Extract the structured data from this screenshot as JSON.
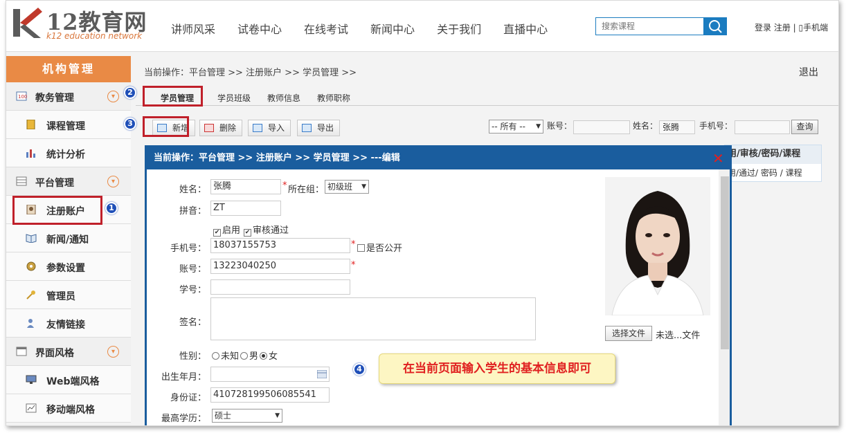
{
  "header": {
    "logo_main": "12教育网",
    "logo_sub": "k12 education network",
    "nav": [
      "讲师风采",
      "试卷中心",
      "在线考试",
      "新闻中心",
      "关于我们",
      "直播中心"
    ],
    "search_placeholder": "搜索课程",
    "top_links": "登录 注册 | ▯手机端"
  },
  "sidebar": {
    "title": "机构管理",
    "items": [
      {
        "label": "教务管理",
        "icon": "score-icon",
        "group": true
      },
      {
        "label": "课程管理",
        "icon": "book-icon"
      },
      {
        "label": "统计分析",
        "icon": "bar-chart-icon"
      },
      {
        "label": "平台管理",
        "icon": "grid-icon",
        "group": true
      },
      {
        "label": "注册账户",
        "icon": "user-card-icon"
      },
      {
        "label": "新闻/通知",
        "icon": "open-book-icon"
      },
      {
        "label": "参数设置",
        "icon": "gear-icon"
      },
      {
        "label": "管理员",
        "icon": "key-icon"
      },
      {
        "label": "友情链接",
        "icon": "link-icon"
      },
      {
        "label": "界面风格",
        "icon": "window-icon",
        "group": true
      },
      {
        "label": "Web端风格",
        "icon": "monitor-icon"
      },
      {
        "label": "移动端风格",
        "icon": "chart-icon"
      }
    ]
  },
  "main": {
    "breadcrumb": "当前操作：平台管理 >> 注册账户 >> 学员管理 >>",
    "logout": "退出",
    "tabs": [
      "学员管理",
      "学员班级",
      "教师信息",
      "教师职称"
    ],
    "toolbar": {
      "add": "新增",
      "delete": "删除",
      "import": "导入",
      "export": "导出"
    },
    "filter": {
      "all": "-- 所有 --",
      "account_label": "账号：",
      "name_label": "姓名：",
      "name_value": "张腾",
      "phone_label": "手机号：",
      "query": "查询"
    },
    "table_header": "用/审核/密码/课程",
    "table_row": "用/通过/ 密码 / 课程"
  },
  "dialog": {
    "title": "当前操作：平台管理 >> 注册账户 >> 学员管理 >> ---编辑",
    "name_label": "姓名：",
    "name_value": "张腾",
    "group_label": "所在组：",
    "group_value": "初级班",
    "pinyin_label": "拼音：",
    "pinyin_value": "ZT",
    "enable_label": "启用",
    "audit_label": "审核通过",
    "phone_label": "手机号：",
    "phone_value": "18037155753",
    "public_label": "是否公开",
    "account_label": "账号：",
    "account_value": "13223040250",
    "student_no_label": "学号：",
    "signature_label": "签名：",
    "gender_label": "性别：",
    "gender_options": [
      "未知",
      "男",
      "女"
    ],
    "birth_label": "出生年月：",
    "id_label": "身份证：",
    "id_value": "410728199506085541",
    "edu_label": "最高学历：",
    "edu_value": "硕士",
    "file_button": "选择文件",
    "file_status": "未选...文件"
  },
  "callout": "在当前页面输入学生的基本信息即可",
  "badges": [
    "1",
    "2",
    "3",
    "4"
  ],
  "colors": {
    "accent": "#e98a45",
    "dialog_blue": "#1a5d9e",
    "highlight": "#c0202a",
    "badge": "#1f4fb8"
  }
}
